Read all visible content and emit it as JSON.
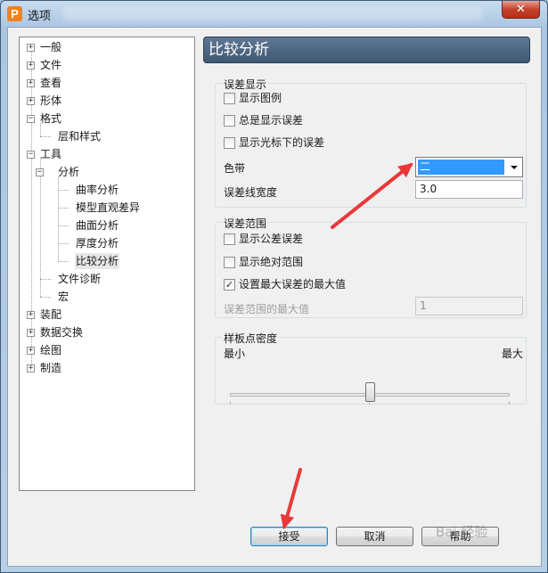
{
  "window": {
    "title": "选项",
    "app_icon_letter": "P",
    "close_glyph": "✕"
  },
  "tree": {
    "items": [
      {
        "label": "一般",
        "box": "+"
      },
      {
        "label": "文件",
        "box": "+"
      },
      {
        "label": "查看",
        "box": "+"
      },
      {
        "label": "形体",
        "box": "+"
      },
      {
        "label": "格式",
        "box": "−"
      },
      {
        "label": "层和样式",
        "box": ""
      },
      {
        "label": "工具",
        "box": "−"
      },
      {
        "label": "分析",
        "box": "−"
      },
      {
        "label": "曲率分析",
        "box": ""
      },
      {
        "label": "模型直观差异",
        "box": ""
      },
      {
        "label": "曲面分析",
        "box": ""
      },
      {
        "label": "厚度分析",
        "box": ""
      },
      {
        "label": "比较分析",
        "box": "",
        "selected": true
      },
      {
        "label": "文件诊断",
        "box": ""
      },
      {
        "label": "宏",
        "box": ""
      },
      {
        "label": "装配",
        "box": "+"
      },
      {
        "label": "数据交换",
        "box": "+"
      },
      {
        "label": "绘图",
        "box": "+"
      },
      {
        "label": "制造",
        "box": "+"
      }
    ]
  },
  "panel": {
    "title": "比较分析",
    "error_display": {
      "title": "误差显示",
      "show_legend": {
        "label": "显示图例",
        "checked": false
      },
      "always_show_error": {
        "label": "总是显示误差",
        "checked": false
      },
      "show_error_under_cursor": {
        "label": "显示光标下的误差",
        "checked": false
      },
      "color_band_label": "色带",
      "color_band_value": "二",
      "error_line_width_label": "误差线宽度",
      "error_line_width_value": "3.0"
    },
    "error_range": {
      "title": "误差范围",
      "show_tolerance_error": {
        "label": "显示公差误差",
        "checked": false
      },
      "show_absolute_range": {
        "label": "显示绝对范围",
        "checked": false
      },
      "set_max_error": {
        "label": "设置最大误差的最大值",
        "checked": true
      },
      "max_range_label": "误差范围的最大值",
      "max_range_value": "1"
    },
    "sample_density": {
      "title": "样板点密度",
      "min_label": "最小",
      "max_label": "最大",
      "level": 0.5
    }
  },
  "buttons": {
    "accept": "接受",
    "cancel": "取消",
    "help": "帮助"
  },
  "watermark": "Bai 经验",
  "colors": {
    "accent": "#3399ff",
    "header": "#4b6480",
    "annotation_arrow": "#e8393a"
  }
}
